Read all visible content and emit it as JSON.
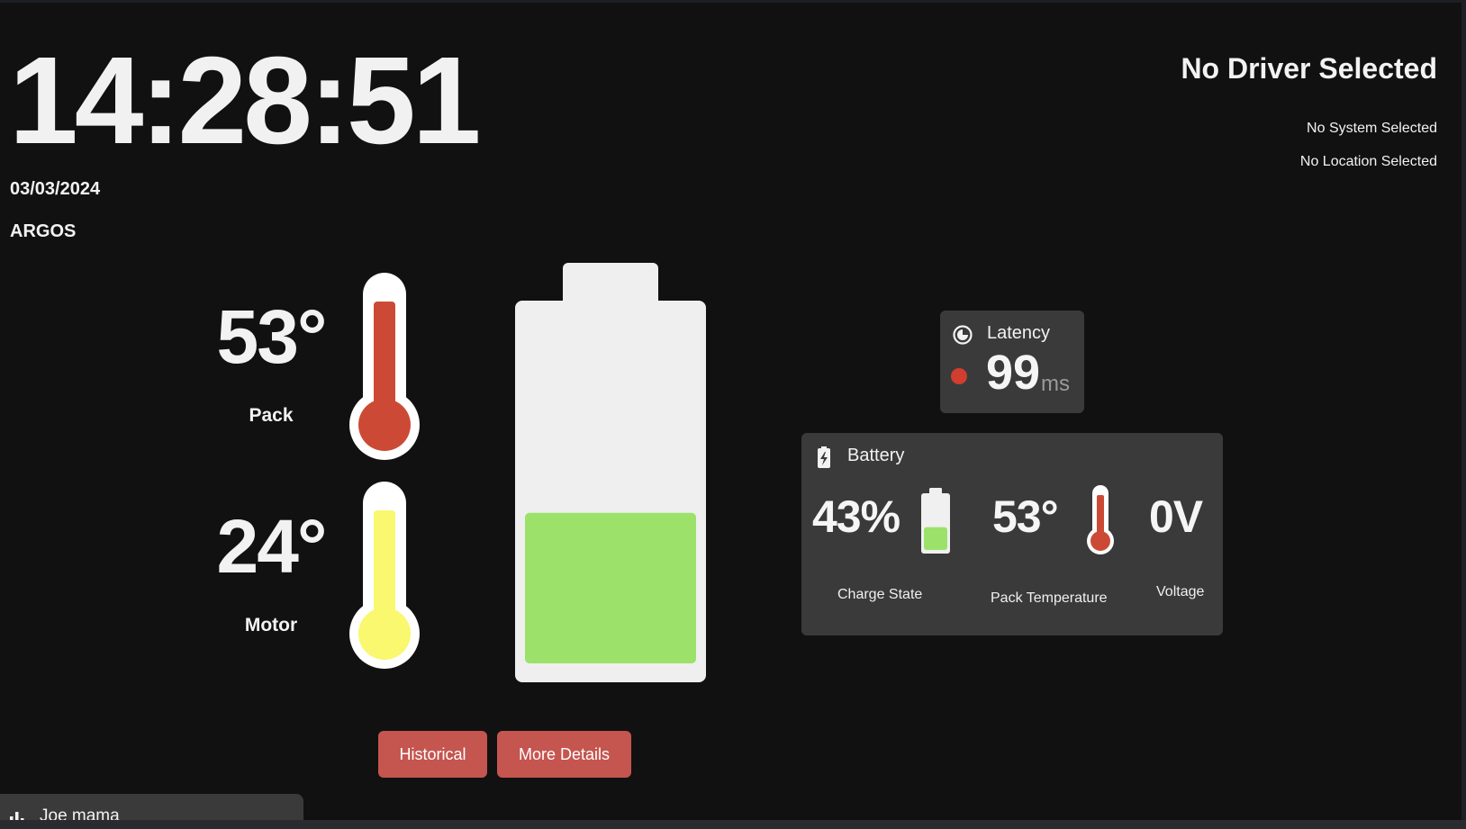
{
  "clock": {
    "time": "14:28:51",
    "date": "03/03/2024",
    "brand": "ARGOS"
  },
  "selection": {
    "driver": "No Driver Selected",
    "system": "No System Selected",
    "location": "No Location Selected"
  },
  "thermometers": [
    {
      "value": "53°",
      "label": "Pack",
      "level": 0.53,
      "color": "#cc4a35"
    },
    {
      "value": "24°",
      "label": "Motor",
      "level": 0.24,
      "color": "#f9f86f"
    }
  ],
  "main_battery": {
    "charge_percent": 43,
    "fill_color": "#9ce26a",
    "body_color": "#efefef"
  },
  "buttons": {
    "historical": "Historical",
    "more_details": "More Details"
  },
  "latency": {
    "title": "Latency",
    "value": "99",
    "unit": "ms",
    "status_color": "#d13d2f",
    "icon": "clock-icon"
  },
  "battery_card": {
    "title": "Battery",
    "icon": "battery-charging-icon",
    "charge_value": "43%",
    "charge_label": "Charge State",
    "temp_value": "53°",
    "temp_label": "Pack Temperature",
    "voltage_value": "0V",
    "voltage_label": "Voltage"
  },
  "bottom_tab": {
    "label": "Joe mama",
    "icon": "bar-chart-icon"
  },
  "colors": {
    "background": "#111112",
    "card": "#3a3a3b",
    "button": "#c5554f"
  }
}
